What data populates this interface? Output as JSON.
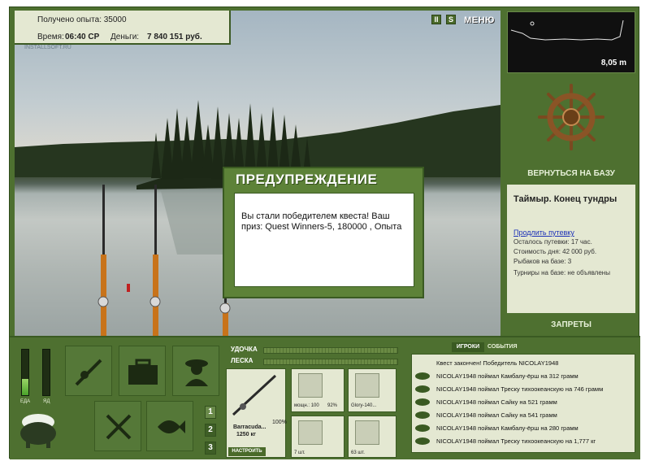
{
  "hud": {
    "experience": "Получено опыта: 35000",
    "time_label": "Время:",
    "time_value": "06:40 СР",
    "money_label": "Деньги:",
    "money_value": "7 840 151 руб.",
    "pause_label": "II",
    "sound_label": "S",
    "menu_label": "МЕНЮ"
  },
  "watermark": "INSTALLSOFT.RU",
  "dialog": {
    "title": "ПРЕДУПРЕЖДЕНИЕ",
    "message": "Вы стали победителем квеста! Ваш приз: Quest Winners-5, 180000 , Опыта"
  },
  "depth": {
    "value": "8,05 m"
  },
  "right_panel": {
    "return_label": "ВЕРНУТЬСЯ НА БАЗУ",
    "location": "Таймыр. Конец тундры",
    "extend_link": "Продлить путевку",
    "lines": [
      "Осталось путевки: 17 час.",
      "Стоимость дня: 42 000 руб.",
      "Рыбаков на базе: 3",
      "Турниры на базе: не объявлены"
    ],
    "bans_label": "ЗАПРЕТЫ"
  },
  "gauges": {
    "food_label": "ЕДА",
    "poison_label": "ЯД",
    "food_level": 0.35,
    "poison_level": 0.0
  },
  "actions": [
    {
      "id": "rods",
      "icon": "rod-reel-icon"
    },
    {
      "id": "tackle-box",
      "icon": "tackle-box-icon"
    },
    {
      "id": "fisherman",
      "icon": "fisherman-icon"
    },
    {
      "id": "food",
      "icon": "fork-knife-icon"
    },
    {
      "id": "catch",
      "icon": "fish-icon"
    }
  ],
  "slots": [
    "1",
    "2",
    "3"
  ],
  "tackle": {
    "rod_label": "УДОЧКА",
    "line_label": "ЛЕСКА",
    "rod_name": "Barracuda...",
    "rod_weight": "1250 кг",
    "rod_percent": "100%",
    "setup_label": "НАСТРОИТЬ",
    "items": [
      {
        "caption": "мощн.: 100",
        "extra": "92%"
      },
      {
        "caption": "Glory-140..."
      },
      {
        "caption": "7 шт."
      },
      {
        "caption": "63 шт."
      }
    ]
  },
  "events": {
    "tab_players": "ИГРОКИ",
    "tab_events": "СОБЫТИЯ",
    "items": [
      "Квест закончен! Победитель NICOLAY1948",
      "NICOLAY1948 поймал Камбалу-ёрш на 312 грамм",
      "NICOLAY1948 поймал Треску тихоокеанскую на 746 грамм",
      "NICOLAY1948 поймал Сайку на 521 грамм",
      "NICOLAY1948 поймал Сайку на 541 грамм",
      "NICOLAY1948 поймал Камбалу-ёрш на 280 грамм",
      "NICOLAY1948 поймал Треску тихоокеанскую на 1,777 кг"
    ]
  }
}
